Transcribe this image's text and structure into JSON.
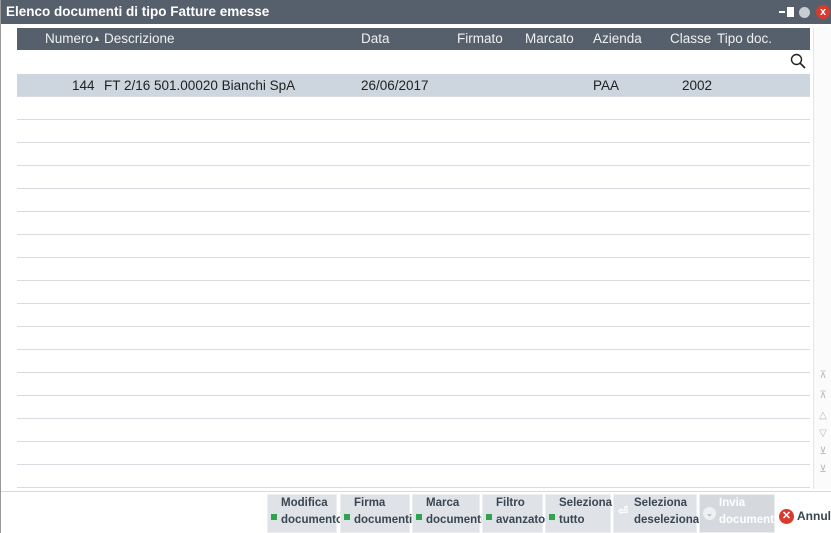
{
  "window": {
    "title": "Elenco documenti di tipo Fatture emesse",
    "close_glyph": "x"
  },
  "columns": {
    "numero": "Numero",
    "descrizione": "Descrizione",
    "data": "Data",
    "firmato": "Firmato",
    "marcato": "Marcato",
    "azienda": "Azienda",
    "classe": "Classe",
    "tipo_doc": "Tipo doc.",
    "sort_indicator": "▲"
  },
  "filter": {
    "value": "",
    "search_icon": "search-icon"
  },
  "rows": [
    {
      "numero": "144",
      "descrizione": "FT 2/16 501.00020 Bianchi SpA",
      "data": "26/06/2017",
      "firmato": "",
      "marcato": "",
      "azienda": "PAA",
      "classe": "2002",
      "tipo_doc": ""
    }
  ],
  "toolbar": {
    "modifica": {
      "line1": "Modifica",
      "line2": "documento"
    },
    "firma": {
      "line1": "Firma",
      "line2": "documenti"
    },
    "marca": {
      "line1": "Marca",
      "line2": "documenti"
    },
    "filtro": {
      "line1": "Filtro",
      "line2": "avanzato"
    },
    "seleziona_tutto": {
      "line1": "Seleziona",
      "line2": "tutto"
    },
    "seleziona_deseleziona": {
      "line1": "Seleziona",
      "line2": "deseleziona"
    },
    "invia": {
      "line1": "Invia",
      "line2": "documenti"
    },
    "annulla": "Annull"
  },
  "colors": {
    "titlebar": "#56606c",
    "selected_row": "#cdd5de",
    "shortcut_key": "#2ea44f",
    "cancel": "#d83a2e"
  }
}
